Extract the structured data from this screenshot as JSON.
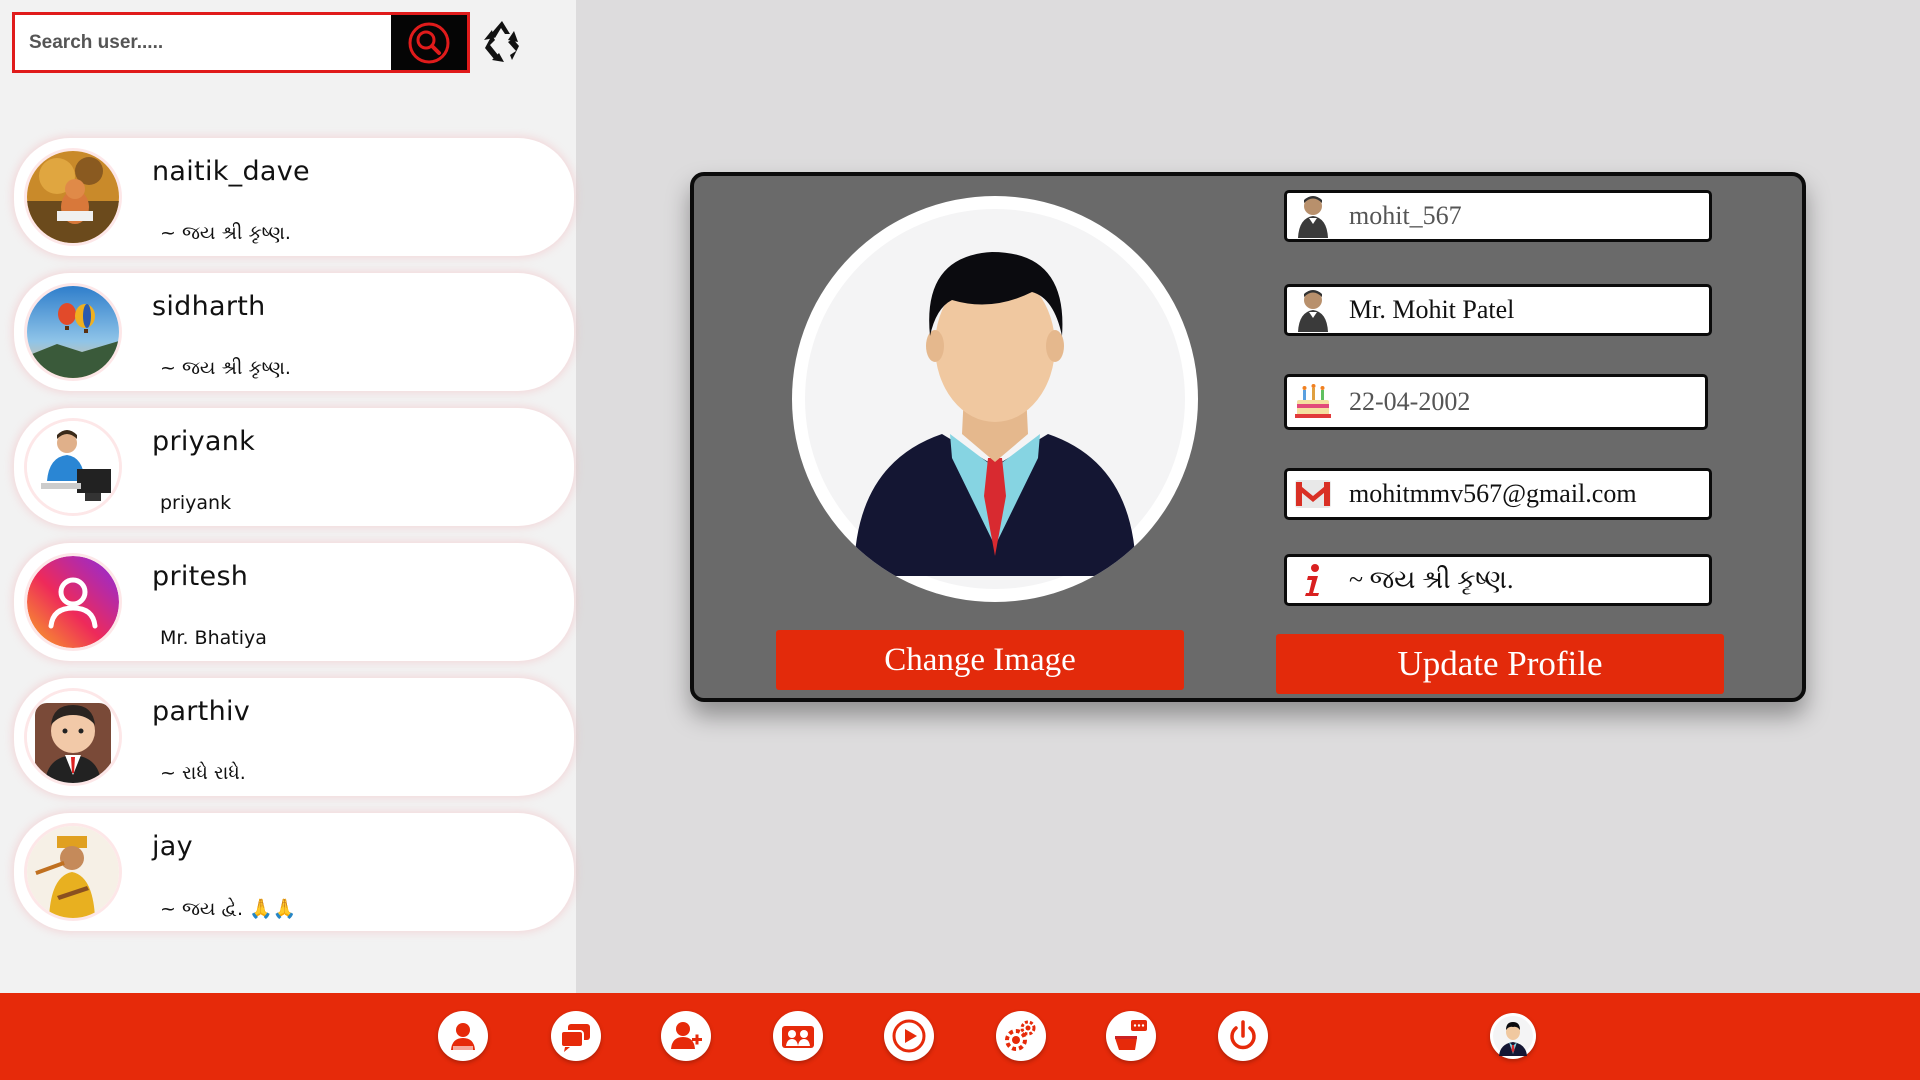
{
  "search": {
    "placeholder": "Search user....."
  },
  "users": [
    {
      "name": "naitik_dave",
      "status": "~ જય શ્રી કૃષ્ણ."
    },
    {
      "name": "sidharth",
      "status": "~ જય શ્રી કૃષ્ણ."
    },
    {
      "name": "priyank",
      "status": "priyank"
    },
    {
      "name": "pritesh",
      "status": "Mr. Bhatiya"
    },
    {
      "name": "parthiv",
      "status": "~ રાધે રાધે."
    },
    {
      "name": "jay",
      "status": "~ જય દ્વે. 🙏🙏"
    }
  ],
  "profile": {
    "username": "mohit_567",
    "full_name": "Mr. Mohit Patel",
    "dob": "22-04-2002",
    "email": "mohitmmv567@gmail.com",
    "about": "~ જય શ્રી કૃષ્ણ.",
    "change_image_label": "Change Image",
    "update_label": "Update Profile"
  },
  "nav": {
    "items": [
      "my-profile-icon",
      "chat-icon",
      "add-user-icon",
      "group-icon",
      "video-icon",
      "settings-icon",
      "feedback-icon",
      "power-icon",
      "account-avatar"
    ]
  },
  "colors": {
    "accent": "#e62a0a",
    "panel": "#6a6a6a",
    "search_border": "#e01b1b"
  }
}
